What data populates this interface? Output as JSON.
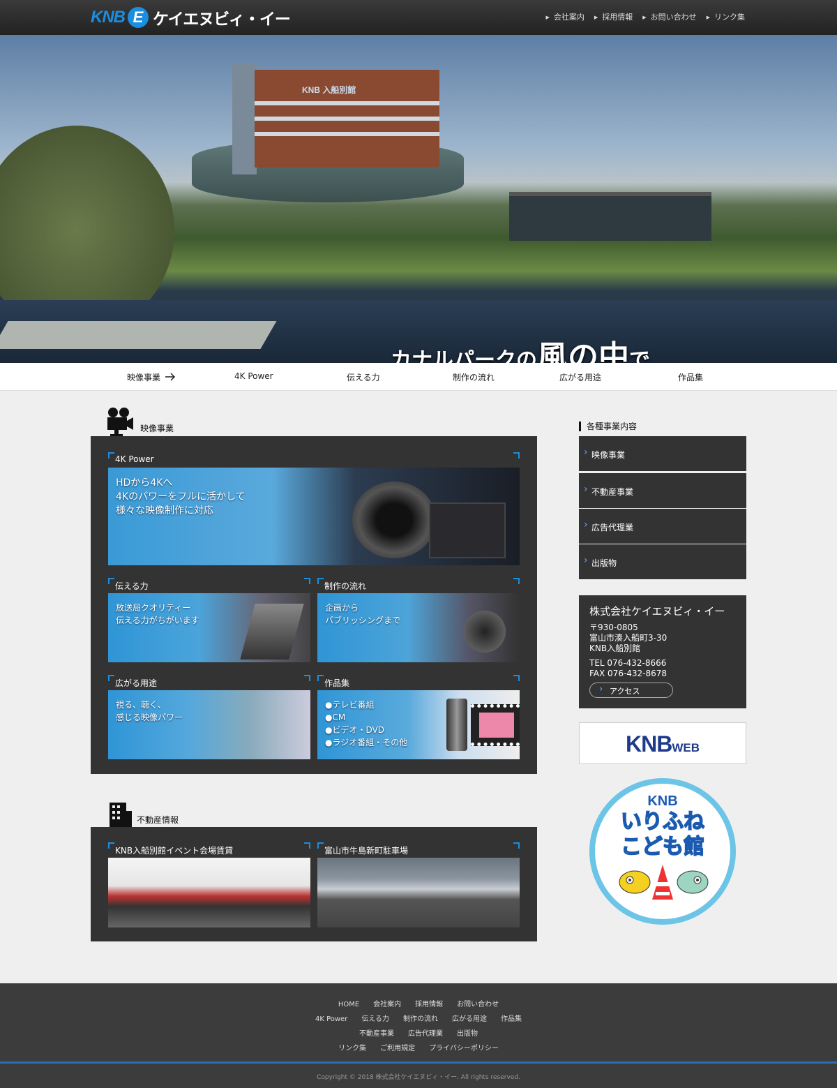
{
  "header": {
    "logo_knb": "KNB",
    "logo_e": "E",
    "logo_name": "ケイエヌビィ・イー",
    "nav": [
      "会社案内",
      "採用情報",
      "お問い合わせ",
      "リンク集"
    ]
  },
  "hero": {
    "building_sign": "KNB 入船別館",
    "catch_pre": "カナルパークの",
    "catch_big": "風の中",
    "catch_post": "で…"
  },
  "subnav": [
    "映像事業",
    "4K Power",
    "伝える力",
    "制作の流れ",
    "広がる用途",
    "作品集"
  ],
  "video": {
    "title": "映像事業",
    "cards": [
      {
        "label": "4K Power",
        "lines": [
          "HDから4Kへ",
          "4Kのパワーをフルに活かして",
          "様々な映像制作に対応"
        ]
      },
      {
        "label": "伝える力",
        "lines": [
          "放送局クオリティー",
          "伝える力がちがいます"
        ]
      },
      {
        "label": "制作の流れ",
        "lines": [
          "企画から",
          "パブリッシングまで"
        ]
      },
      {
        "label": "広がる用途",
        "lines": [
          "視る、聴く、",
          "感じる映像パワー"
        ]
      },
      {
        "label": "作品集",
        "lines": [
          "●テレビ番組",
          "●CM",
          "●ビデオ・DVD",
          "●ラジオ番組・その他"
        ]
      }
    ]
  },
  "realestate": {
    "title": "不動産情報",
    "cards": [
      {
        "label": "KNB入船別館イベント会場賃貸"
      },
      {
        "label": "富山市牛島新町駐車場"
      }
    ]
  },
  "side": {
    "title": "各種事業内容",
    "menu": [
      "映像事業",
      "不動産事業",
      "広告代理業",
      "出版物"
    ],
    "company": {
      "name": "株式会社ケイエヌビィ・イー",
      "zip": "〒930-0805",
      "addr": "富山市湊入船町3-30",
      "bldg": "KNB入船別館",
      "tel": "TEL 076-432-8666",
      "fax": "FAX 076-432-8678",
      "access": "アクセス"
    },
    "knbweb_a": "KNB",
    "knbweb_b": "WEB",
    "kids_1": "KNB",
    "kids_2": "いりふね",
    "kids_3": "こども館"
  },
  "footer": {
    "row1": [
      "HOME",
      "会社案内",
      "採用情報",
      "お問い合わせ"
    ],
    "row2": [
      "4K Power",
      "伝える力",
      "制作の流れ",
      "広がる用途",
      "作品集"
    ],
    "row3": [
      "不動産事業",
      "広告代理業",
      "出版物"
    ],
    "row4": [
      "リンク集",
      "ご利用規定",
      "プライバシーポリシー"
    ],
    "copyright": "Copyright © 2018 株式会社ケイエヌビィ・イー. All rights reserved."
  }
}
